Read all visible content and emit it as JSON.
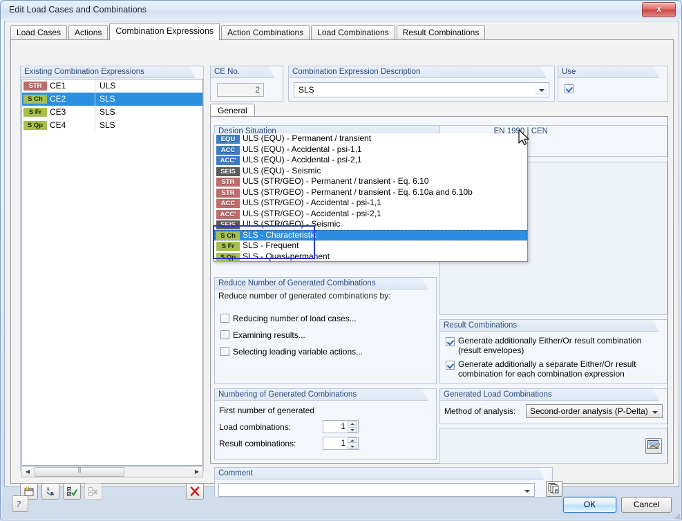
{
  "window": {
    "title": "Edit Load Cases and Combinations",
    "close_label": "x"
  },
  "tabs": [
    {
      "label": "Load Cases",
      "active": false
    },
    {
      "label": "Actions",
      "active": false
    },
    {
      "label": "Combination Expressions",
      "active": true
    },
    {
      "label": "Action Combinations",
      "active": false
    },
    {
      "label": "Load Combinations",
      "active": false
    },
    {
      "label": "Result Combinations",
      "active": false
    }
  ],
  "existing": {
    "title": "Existing Combination Expressions",
    "rows": [
      {
        "badge": "STR",
        "badge_class": "b-str",
        "name": "CE1",
        "value": "ULS",
        "selected": false
      },
      {
        "badge": "S Ch",
        "badge_class": "b-sls",
        "name": "CE2",
        "value": "SLS",
        "selected": true
      },
      {
        "badge": "S Fr",
        "badge_class": "b-sls",
        "name": "CE3",
        "value": "SLS",
        "selected": false
      },
      {
        "badge": "S Qp",
        "badge_class": "b-sls",
        "name": "CE4",
        "value": "SLS",
        "selected": false
      }
    ],
    "toolbar": [
      {
        "name": "new-combination-expression-button",
        "icon": "new-page-icon",
        "disabled": false
      },
      {
        "name": "rename-button",
        "icon": "rename-ab-icon",
        "disabled": false
      },
      {
        "name": "select-all-button",
        "icon": "checklist-icon",
        "disabled": false
      },
      {
        "name": "deselect-all-button",
        "icon": "uncheck-icon",
        "disabled": true
      },
      {
        "name": "delete-button",
        "icon": "red-x-icon",
        "disabled": false
      }
    ]
  },
  "ce_no": {
    "title": "CE No.",
    "value": "2"
  },
  "description": {
    "title": "Combination Expression Description",
    "value": "SLS"
  },
  "use": {
    "title": "Use",
    "checked": true
  },
  "general_tab": {
    "label": "General"
  },
  "design_situation": {
    "title": "Design Situation",
    "standard": "EN 1990 | CEN",
    "value": "SLS - Characteristic",
    "value_badge": "S Ch",
    "value_badge_class": "b-sls",
    "options": [
      {
        "badge": "EQU",
        "badge_class": "b-equ",
        "label": "ULS (EQU) - Permanent / transient",
        "selected": false
      },
      {
        "badge": "ACC",
        "badge_class": "b-acc",
        "label": "ULS (EQU) - Accidental - psi-1,1",
        "selected": false
      },
      {
        "badge": "ACC'",
        "badge_class": "b-acc",
        "label": "ULS (EQU) - Accidental - psi-2,1",
        "selected": false
      },
      {
        "badge": "SEIS",
        "badge_class": "b-seis",
        "label": "ULS (EQU) - Seismic",
        "selected": false
      },
      {
        "badge": "STR",
        "badge_class": "b-str",
        "label": "ULS (STR/GEO) - Permanent / transient - Eq. 6.10",
        "selected": false
      },
      {
        "badge": "STR",
        "badge_class": "b-str",
        "label": "ULS (STR/GEO) - Permanent / transient - Eq. 6.10a and 6.10b",
        "selected": false
      },
      {
        "badge": "ACC",
        "badge_class": "b-accr",
        "label": "ULS (STR/GEO) - Accidental - psi-1,1",
        "selected": false
      },
      {
        "badge": "ACC'",
        "badge_class": "b-accr",
        "label": "ULS (STR/GEO) - Accidental - psi-2,1",
        "selected": false
      },
      {
        "badge": "SEIS",
        "badge_class": "b-seis",
        "label": "ULS (STR/GEO) - Seismic",
        "selected": false
      },
      {
        "badge": "S Ch",
        "badge_class": "b-sls",
        "label": "SLS - Characteristic",
        "selected": true
      },
      {
        "badge": "S Fr",
        "badge_class": "b-sls",
        "label": "SLS - Frequent",
        "selected": false
      },
      {
        "badge": "S Qp",
        "badge_class": "b-sls",
        "label": "SLS - Quasi-permanent",
        "selected": false
      }
    ]
  },
  "reduce": {
    "title": "Reduce Number of Generated Combinations",
    "hint": "Reduce number of generated combinations by:",
    "options": [
      {
        "label": "Reducing number of load cases...",
        "checked": false
      },
      {
        "label": "Examining results...",
        "checked": false
      },
      {
        "label": "Selecting leading variable actions...",
        "checked": false
      }
    ]
  },
  "numbering": {
    "title": "Numbering of Generated Combinations",
    "hint": "First number of generated",
    "load_label": "Load combinations:",
    "load_value": "1",
    "result_label": "Result combinations:",
    "result_value": "1"
  },
  "result_combinations": {
    "title": "Result Combinations",
    "options": [
      {
        "label": "Generate additionally Either/Or result combination (result envelopes)",
        "checked": true
      },
      {
        "label": "Generate additionally a separate Either/Or result combination for each combination expression",
        "checked": true
      }
    ]
  },
  "generated_load_combinations": {
    "title": "Generated Load Combinations",
    "method_label": "Method of analysis:",
    "method_value": "Second-order analysis (P-Delta)"
  },
  "comment": {
    "title": "Comment",
    "value": ""
  },
  "footer": {
    "ok_label": "OK",
    "cancel_label": "Cancel"
  }
}
